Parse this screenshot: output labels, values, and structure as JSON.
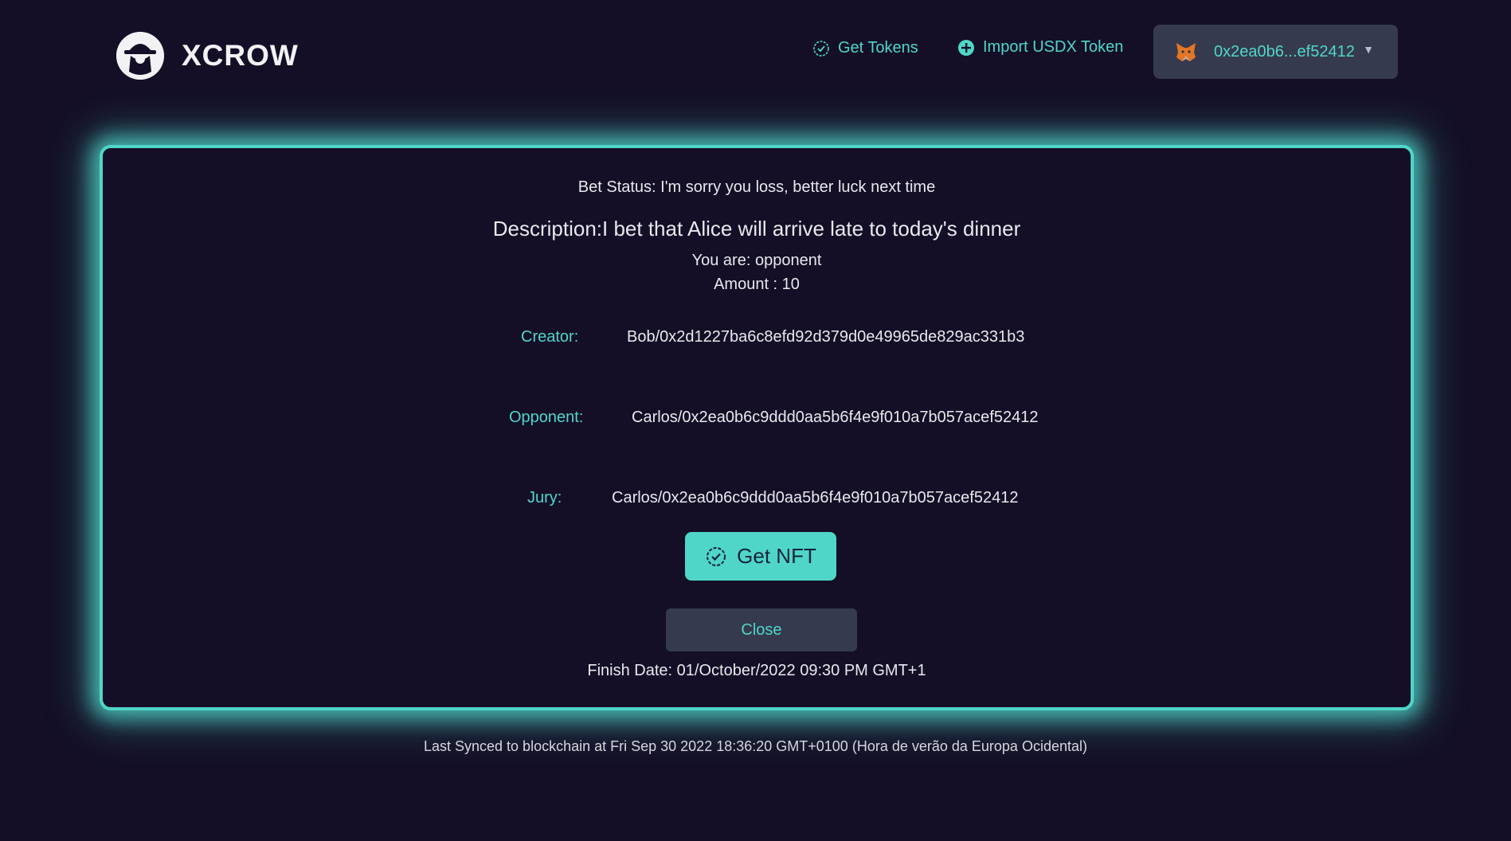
{
  "header": {
    "brand": "XCROW",
    "get_tokens_label": "Get Tokens",
    "import_token_label": "Import USDX Token",
    "wallet_address": "0x2ea0b6...ef52412",
    "wallet_caret": "▼"
  },
  "bet": {
    "status": "Bet Status: I'm sorry you loss, better luck next time",
    "description": "Description:I bet that Alice will arrive late to today's dinner",
    "role": "You are: opponent",
    "amount": "Amount : 10",
    "creator_label": "Creator:",
    "creator_value": "Bob/0x2d1227ba6c8efd92d379d0e49965de829ac331b3",
    "opponent_label": "Opponent:",
    "opponent_value": "Carlos/0x2ea0b6c9ddd0aa5b6f4e9f010a7b057acef52412",
    "jury_label": "Jury:",
    "jury_value": "Carlos/0x2ea0b6c9ddd0aa5b6f4e9f010a7b057acef52412",
    "get_nft_label": "Get NFT",
    "close_label": "Close",
    "finish_date": "Finish Date: 01/October/2022 09:30 PM GMT+1"
  },
  "footer": {
    "sync_text": "Last Synced to blockchain at Fri Sep 30 2022 18:36:20 GMT+0100 (Hora de verão da Europa Ocidental)"
  },
  "colors": {
    "background": "#140f26",
    "accent": "#4fd6c8",
    "button_dark": "#363a4e"
  },
  "icons": {
    "logo": "hat-spy-logo-icon",
    "get_tokens": "check-badge-icon",
    "import_token": "plus-circle-icon",
    "wallet": "metamask-fox-icon",
    "get_nft": "check-badge-icon"
  }
}
